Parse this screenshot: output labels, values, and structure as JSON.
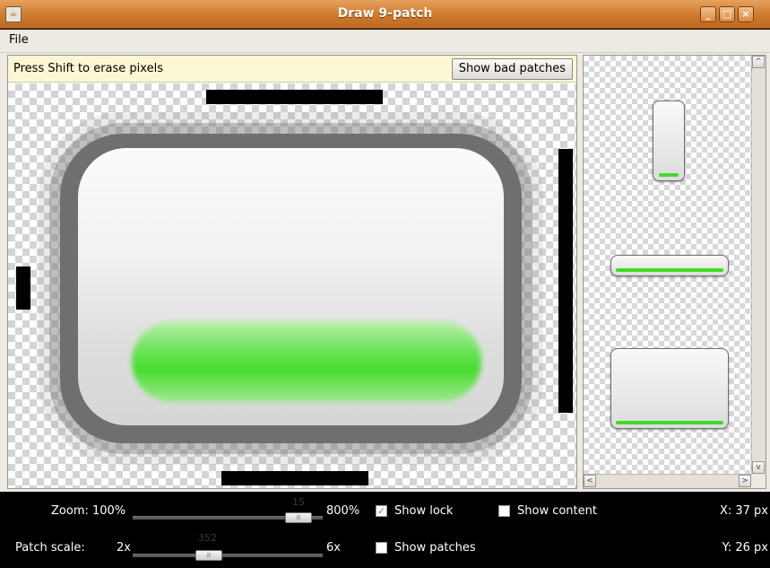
{
  "window": {
    "title": "Draw 9-patch"
  },
  "menu": {
    "file": "File"
  },
  "editor": {
    "hint": "Press Shift to erase pixels",
    "bad_patches_button": "Show bad patches"
  },
  "controls": {
    "zoom_label": "Zoom: 100%",
    "zoom_max": "800%",
    "zoom_value": "15",
    "patch_scale_label": "Patch scale:",
    "patch_min": "2x",
    "patch_max": "6x",
    "patch_value": "352",
    "show_lock": {
      "label": "Show lock",
      "checked": true
    },
    "show_content": {
      "label": "Show content",
      "checked": false
    },
    "show_patches": {
      "label": "Show patches",
      "checked": false
    },
    "x_coord": "X: 37 px",
    "y_coord": "Y: 26 px"
  },
  "colors": {
    "titlebar": "#cf7a2e",
    "patch_green": "#3fdd25",
    "checkbox_accent": "#d0741f"
  }
}
